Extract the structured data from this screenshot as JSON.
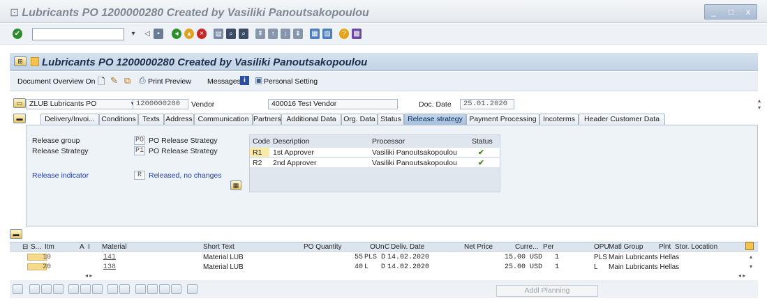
{
  "window": {
    "title": "Lubricants PO 1200000280 Created by Vasiliki Panoutsakopoulou",
    "controls": [
      "_",
      "□",
      "x"
    ]
  },
  "system_toolbar": {
    "command_value": "",
    "icons": [
      "enter-icon",
      "back-icon",
      "save-icon",
      "back-nav-icon",
      "exit-icon",
      "cancel-icon",
      "print-icon",
      "find-icon",
      "find-next-icon",
      "first-page-icon",
      "prev-page-icon",
      "next-page-icon",
      "last-page-icon",
      "new-session-icon",
      "shortcut-icon",
      "help-icon",
      "layout-icon"
    ]
  },
  "app": {
    "title": "Lubricants PO 1200000280 Created by Vasiliki Panoutsakopoulou"
  },
  "app_toolbar": {
    "document_overview": "Document Overview On",
    "print_preview": "Print Preview",
    "messages": "Messages",
    "personal_setting": "Personal Setting"
  },
  "header": {
    "doc_type": "ZLUB Lubricants PO",
    "po_number": "1200000280",
    "vendor_label": "Vendor",
    "vendor_value": "400016 Test Vendor",
    "doc_date_label": "Doc. Date",
    "doc_date_value": "25.01.2020"
  },
  "tabs": [
    {
      "label": "Delivery/Invoi..."
    },
    {
      "label": "Conditions"
    },
    {
      "label": "Texts"
    },
    {
      "label": "Address"
    },
    {
      "label": "Communication"
    },
    {
      "label": "Partners"
    },
    {
      "label": "Additional Data"
    },
    {
      "label": "Org. Data"
    },
    {
      "label": "Status"
    },
    {
      "label": "Release strategy"
    },
    {
      "label": "Payment Processing"
    },
    {
      "label": "Incoterms"
    },
    {
      "label": "Header Customer Data"
    }
  ],
  "release": {
    "group_label": "Release group",
    "group_code": "PO",
    "group_text": "PO Release Strategy",
    "strategy_label": "Release Strategy",
    "strategy_code": "P1",
    "strategy_text": "PO Release Strategy",
    "indicator_label": "Release indicator",
    "indicator_code": "R",
    "indicator_text": "Released, no changes",
    "table_headers": {
      "code": "Code",
      "description": "Description",
      "processor": "Processor",
      "status": "Status"
    },
    "rows": [
      {
        "code": "R1",
        "description": "1st Approver",
        "processor": "Vasiliki Panoutsakopoulou",
        "status": "✔"
      },
      {
        "code": "R2",
        "description": "2nd Approver",
        "processor": "Vasiliki Panoutsakopoulou",
        "status": "✔"
      }
    ]
  },
  "items": {
    "headers": {
      "s": "S...",
      "itm": "Itm",
      "a": "A",
      "i": "I",
      "material": "Material",
      "short_text": "Short Text",
      "po_qty": "PO Quantity",
      "oun": "OUn",
      "c": "C",
      "deliv_date": "Deliv. Date",
      "net_price": "Net Price",
      "curr": "Curre...",
      "per": "Per",
      "opu": "OPU",
      "matl_group": "Matl Group",
      "plnt": "Plnt",
      "stor_loc": "Stor. Location"
    },
    "rows": [
      {
        "itm": "10",
        "material": "141",
        "short_text": "Material LUB",
        "po_qty": "55",
        "oun": "PLS",
        "c": "D",
        "deliv_date": "14.02.2020",
        "net_price": "15.00",
        "curr": "USD",
        "per": "1",
        "opu": "PLS",
        "matl_group": "Main Lubricants Hellas"
      },
      {
        "itm": "20",
        "material": "138",
        "short_text": "Material LUB",
        "po_qty": "40",
        "oun": "L",
        "c": "D",
        "deliv_date": "14.02.2020",
        "net_price": "25.00",
        "curr": "USD",
        "per": "1",
        "opu": "L",
        "matl_group": "Main Lubricants Hellas"
      }
    ]
  },
  "bottom": {
    "addl_planning": "Addl Planning"
  }
}
